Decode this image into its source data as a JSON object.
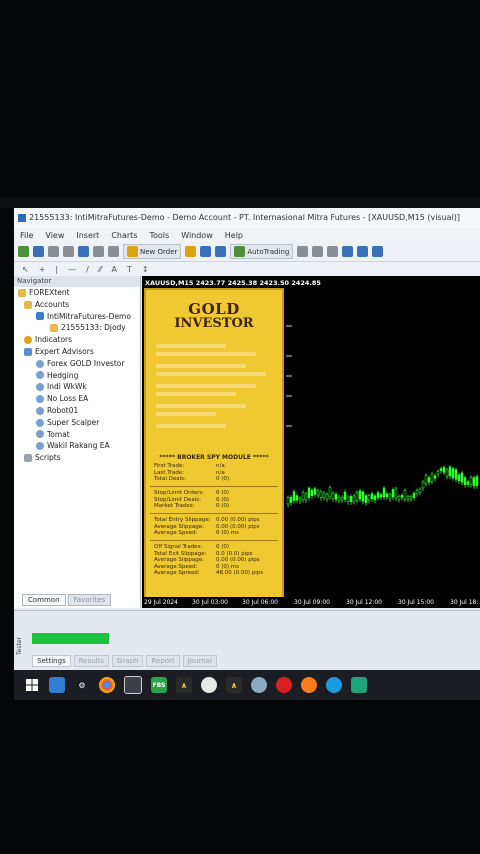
{
  "window": {
    "title": "21555133: IntiMitraFutures-Demo - Demo Account - PT. Internasional Mitra Futures - [XAUUSD,M15 (visual)]"
  },
  "menu": [
    "File",
    "View",
    "Insert",
    "Charts",
    "Tools",
    "Window",
    "Help"
  ],
  "toolbar": {
    "new_order": "New Order",
    "auto_trading": "AutoTrading"
  },
  "toolbar2": [
    "A",
    "T"
  ],
  "navigator": {
    "header": "Navigator",
    "root": "FOREXtent",
    "accounts": "Accounts",
    "account_server": "IntiMitraFutures-Demo",
    "account_id": "21555133: Djody",
    "indicators": "Indicators",
    "expert_advisors": "Expert Advisors",
    "experts": [
      "Forex GOLD Investor",
      "Hedging",
      "Indi WkWk",
      "No Loss EA",
      "Robot01",
      "Super Scalper",
      "Tomat",
      "Wakil Rakang EA"
    ],
    "scripts": "Scripts",
    "tabs": [
      "Common",
      "Favorites"
    ]
  },
  "chart": {
    "title": "XAUUSD,M15  2423.77 2425.38 2423.50 2424.85",
    "time_labels": [
      "29 Jul 2024",
      "30 Jul 03:00",
      "30 Jul 06:00",
      "30 Jul 09:00",
      "30 Jul 12:00",
      "30 Jul 15:00",
      "30 Jul 18:"
    ],
    "candle_color": "#2fff2f"
  },
  "ea_panel": {
    "logo_line1": "GOLD",
    "logo_line2": "INVESTOR",
    "broker_spy": "***** BROKER SPY MODULE *****",
    "trades": [
      {
        "k": "First Trade:",
        "v": "n/a"
      },
      {
        "k": "Last Trade:",
        "v": "n/a"
      },
      {
        "k": "Total Deals:",
        "v": "0 (0)"
      }
    ],
    "orders": [
      {
        "k": "Stop/Limit Orders:",
        "v": "0 (0)"
      },
      {
        "k": "Stop/Limit Deals:",
        "v": "0 (0)"
      },
      {
        "k": "Market Trades:",
        "v": "0 (0)"
      }
    ],
    "entry": [
      {
        "k": "Total Entry Slippage:",
        "v": "0.00 (0.00) pips"
      },
      {
        "k": "Average Slippage:",
        "v": "0.00 (0.00) pips"
      },
      {
        "k": "Average Speed:",
        "v": "0 (0) ms"
      }
    ],
    "exit": [
      {
        "k": "Off Signal Trades:",
        "v": "0 (0)"
      },
      {
        "k": "Total Exit Slippage:",
        "v": "0.0 (0.0) pips"
      },
      {
        "k": "Average Slippage:",
        "v": "0.00 (0.00) pips"
      },
      {
        "k": "Average Speed:",
        "v": "0 (0) ms"
      },
      {
        "k": "Average Spread:",
        "v": "48.00 (0.00) pips"
      }
    ]
  },
  "tester": {
    "side_label": "Tester",
    "progress": 0.18,
    "tabs": [
      "Settings",
      "Results",
      "Graph",
      "Report",
      "Journal"
    ]
  },
  "taskbar": [
    "start",
    "app",
    "settings",
    "chrome",
    "files",
    "fbs",
    "mt",
    "circle",
    "mt",
    "brush",
    "opera",
    "firefox",
    "edge",
    "mt5"
  ]
}
